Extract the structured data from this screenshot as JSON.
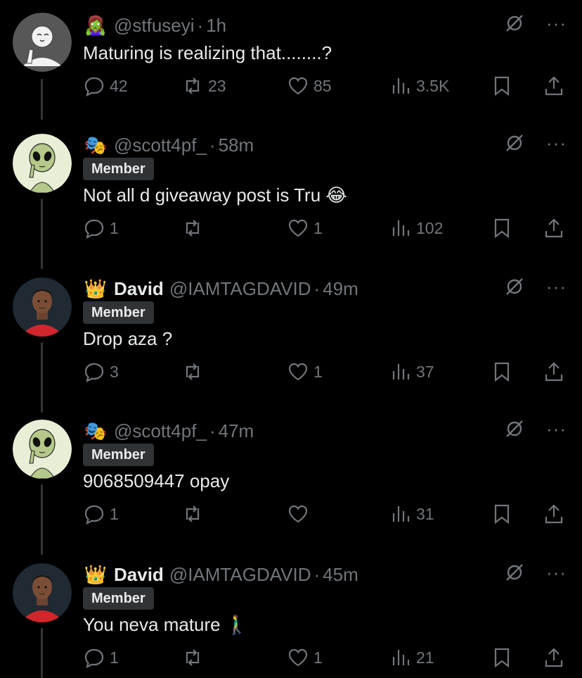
{
  "posts": [
    {
      "emoji": "🧟‍♀️",
      "display_name": "",
      "handle": "@stfuseyi",
      "time": "1h",
      "badge": "",
      "text": "Maturing is realizing that........?",
      "replies": "42",
      "reposts": "23",
      "likes": "85",
      "views": "3.5K",
      "avatar": "placeholder-avatar"
    },
    {
      "emoji": "🎭",
      "display_name": "",
      "handle": "@scott4pf_",
      "time": "58m",
      "badge": "Member",
      "text": "Not all d giveaway post is Tru 😂",
      "replies": "1",
      "reposts": "",
      "likes": "1",
      "views": "102",
      "avatar": "alien-avatar"
    },
    {
      "emoji": "👑",
      "display_name": "David",
      "handle": "@IAMTAGDAVID",
      "time": "49m",
      "badge": "Member",
      "text": "Drop aza ?",
      "replies": "3",
      "reposts": "",
      "likes": "1",
      "views": "37",
      "avatar": "player-avatar"
    },
    {
      "emoji": "🎭",
      "display_name": "",
      "handle": "@scott4pf_",
      "time": "47m",
      "badge": "Member",
      "text": "9068509447 opay",
      "replies": "1",
      "reposts": "",
      "likes": "",
      "views": "31",
      "avatar": "alien-avatar"
    },
    {
      "emoji": "👑",
      "display_name": "David",
      "handle": "@IAMTAGDAVID",
      "time": "45m",
      "badge": "Member",
      "text": "You neva mature 🚶‍♂️",
      "replies": "1",
      "reposts": "",
      "likes": "1",
      "views": "21",
      "avatar": "player-avatar"
    }
  ],
  "ui": {
    "separator": "·",
    "more": "···"
  },
  "colors": {
    "background": "#000000",
    "text": "#e7e9ea",
    "muted": "#71767b",
    "badge_bg": "#2f3336"
  }
}
